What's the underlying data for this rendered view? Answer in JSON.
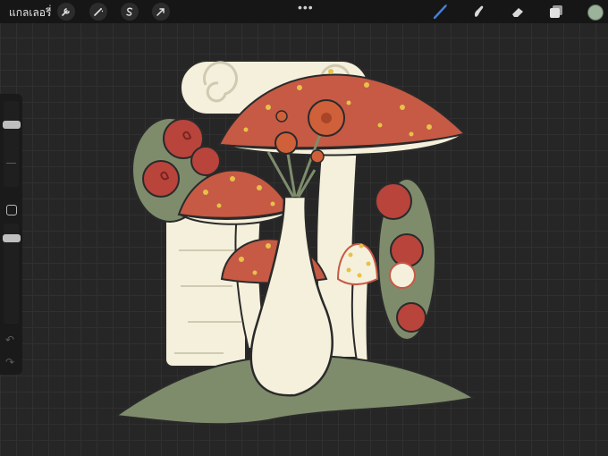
{
  "topbar": {
    "gallery_label": "แกลเลอรี่",
    "more_label": "•••",
    "left_tools": [
      {
        "icon": "wrench-icon",
        "name": "actions"
      },
      {
        "icon": "magic-wand-icon",
        "name": "adjustments"
      },
      {
        "icon": "selection-s-icon",
        "name": "selection"
      },
      {
        "icon": "arrow-cursor-icon",
        "name": "transform"
      }
    ],
    "right_tools": [
      {
        "icon": "brush-icon",
        "name": "brush",
        "active": true
      },
      {
        "icon": "smudge-icon",
        "name": "smudge"
      },
      {
        "icon": "eraser-icon",
        "name": "eraser"
      },
      {
        "icon": "layers-icon",
        "name": "layers"
      }
    ],
    "current_color": "#9bb39a",
    "active_tool_color": "#4a7fd6"
  },
  "sidebar": {
    "brush_size_slider": "brush-size",
    "opacity_slider": "opacity",
    "undo_icon": "undo-icon",
    "redo_icon": "redo-icon"
  },
  "palette": {
    "mushroom_cap": "#c65a45",
    "spots": "#e8c04a",
    "cream": "#f4f0dc",
    "green": "#7e8c6c",
    "rose": "#b8443c",
    "orange_flower": "#d0603a",
    "outline": "#2a2a2a"
  }
}
